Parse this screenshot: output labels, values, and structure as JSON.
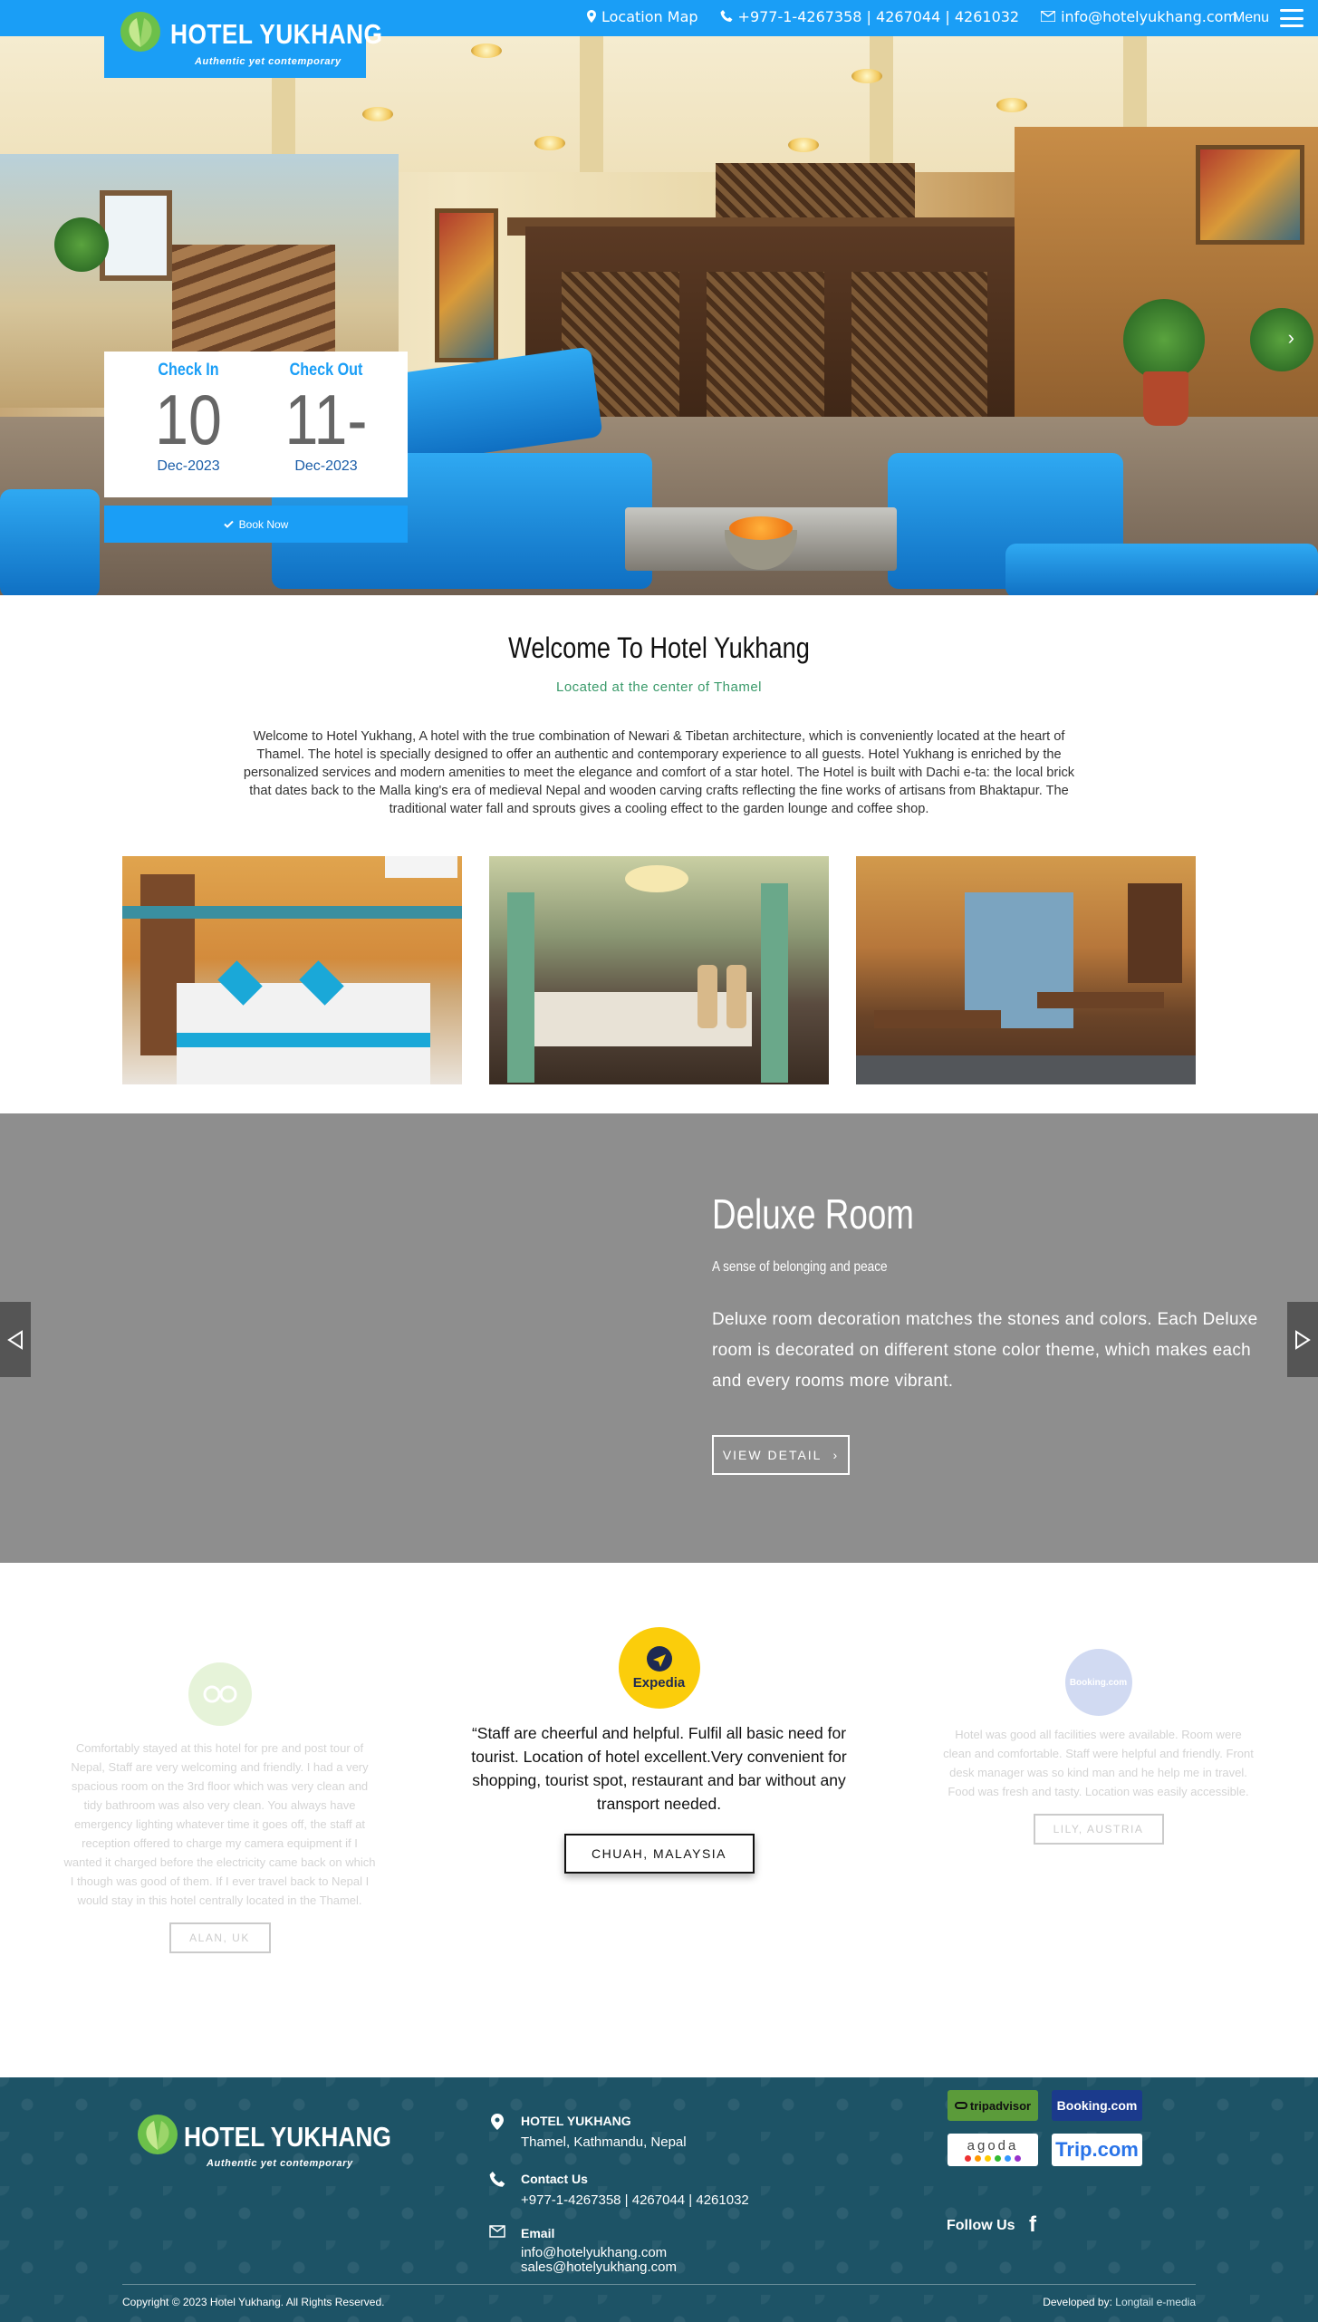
{
  "header": {
    "logo_name": "HOTEL YUKHANG",
    "logo_tagline": "Authentic yet contemporary",
    "location_link": "Location Map",
    "phone": "+977-1-4267358 | 4267044 | 4261032",
    "email": "info@hotelyukhang.com",
    "menu_label": "Menu"
  },
  "booking": {
    "checkin_label": "Check In",
    "checkin_day": "10",
    "checkin_month": "Dec-2023",
    "checkout_label": "Check Out",
    "checkout_day": "11-",
    "checkout_month": "Dec-2023",
    "book_now": "Book Now"
  },
  "welcome": {
    "title": "Welcome To Hotel Yukhang",
    "subtitle": "Located at the center of Thamel",
    "body": "Welcome to Hotel Yukhang, A hotel with the true combination of Newari & Tibetan architecture, which is conveniently located at the heart of Thamel. The hotel is specially designed to offer an authentic and contemporary experience to all guests. Hotel Yukhang is enriched by the personalized services and modern amenities to meet the elegance and comfort of a star hotel. The Hotel is built with Dachi e-ta: the local brick that dates back to the Malla king's era of medieval Nepal and wooden carving crafts reflecting the fine works of artisans from Bhaktapur. The traditional water fall and sprouts gives a cooling effect to the garden lounge and coffee shop."
  },
  "room": {
    "title": "Deluxe Room",
    "subtitle": "A sense of belonging and peace",
    "description": "Deluxe room decoration matches the stones and colors. Each Deluxe room is decorated on different stone color theme, which makes each and every rooms more vibrant.",
    "button": "VIEW DETAIL"
  },
  "reviews": [
    {
      "source": "tripadvisor",
      "text": "Comfortably stayed at this hotel for pre and post tour of Nepal, Staff are very welcoming and friendly. I had a very spacious room on the 3rd floor which was very clean and tidy bathroom was also very clean. You always have emergency lighting whatever time it goes off, the staff at reception offered to charge my camera equipment if I wanted it charged before the electricity came back on which I though was good of them. If I ever travel back to Nepal I would stay in this hotel centrally located in the Thamel.",
      "author": "ALAN, UK"
    },
    {
      "source": "Expedia",
      "text": "“Staff are cheerful and helpful. Fulfil all basic need for tourist. Location of hotel excellent.Very convenient for shopping, tourist spot, restaurant and bar without any transport needed.",
      "author": "CHUAH, MALAYSIA"
    },
    {
      "source": "Booking.com",
      "text": "Hotel was good all facilities were available. Room were clean and comfortable. Staff were helpful and friendly. Front desk manager was so kind man and he help me in travel. Food was fresh and tasty. Location was easily accessible.",
      "author": "LILY, AUSTRIA"
    }
  ],
  "footer": {
    "logo_name": "HOTEL YUKHANG",
    "logo_tagline": "Authentic yet contemporary",
    "address_heading": "HOTEL YUKHANG",
    "address": "Thamel, Kathmandu, Nepal",
    "contact_heading": "Contact Us",
    "contact_phone": "+977-1-4267358 | 4267044 | 4261032",
    "email_heading": "Email",
    "email_1": "info@hotelyukhang.com",
    "email_2": "sales@hotelyukhang.com",
    "badges": [
      "tripadvisor",
      "Booking.com",
      "agoda",
      "Trip.com"
    ],
    "follow_us": "Follow Us",
    "facebook_glyph": "f",
    "copyright": "Copyright © 2023 Hotel Yukhang. All Rights Reserved.",
    "developed_by_label": "Developed by:",
    "developer": "Longtail e-media"
  },
  "colors": {
    "brand_blue": "#1a9ef6",
    "footer_teal": "#1d5366",
    "room_band_gray": "#8e8e8e",
    "welcome_green": "#3a9a6a"
  }
}
